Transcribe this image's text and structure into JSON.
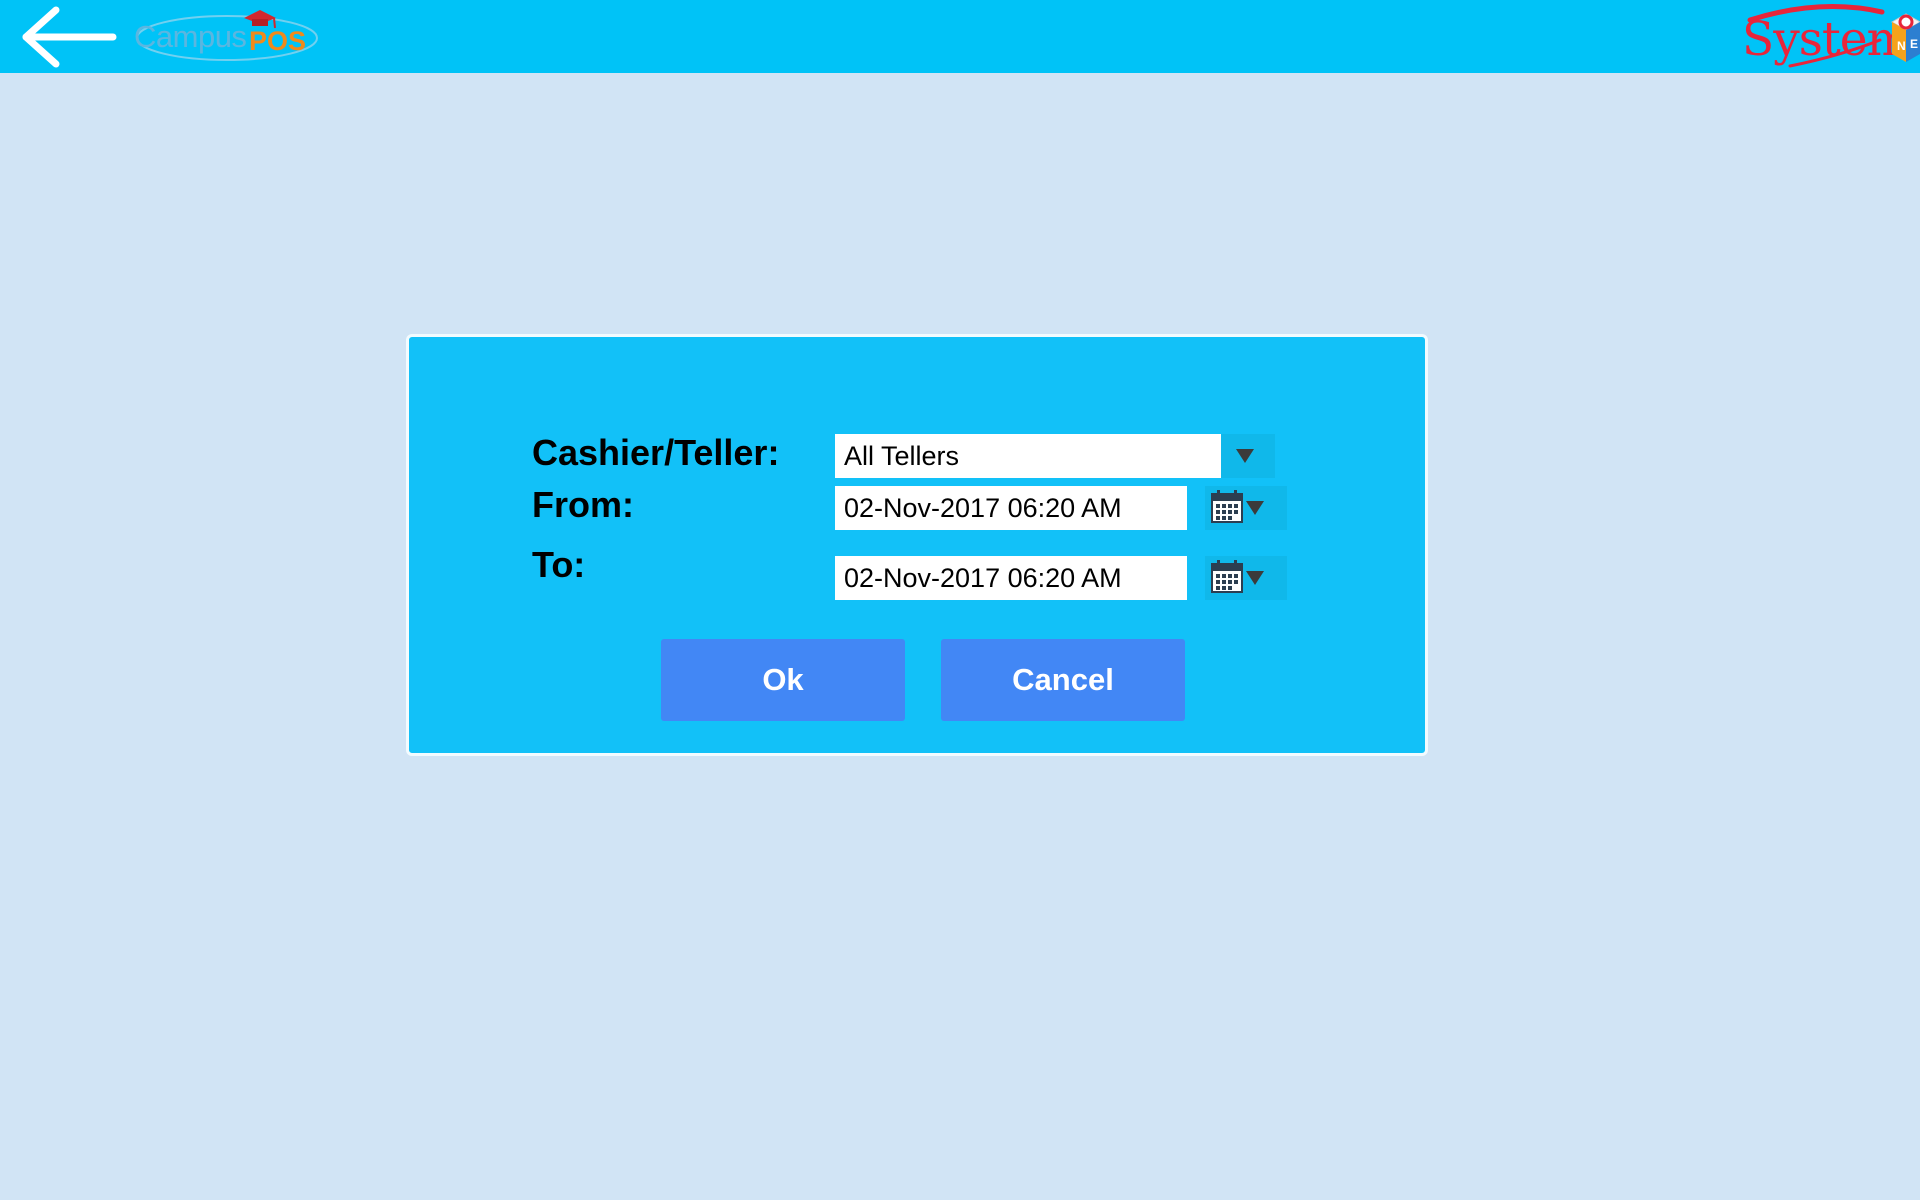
{
  "header": {
    "back_icon": "arrow-left-icon",
    "app_logo": {
      "word1": "Campus",
      "word2": "POS",
      "icon": "graduation-cap-icon"
    },
    "vendor_logo": {
      "word": "System",
      "icon": "cube-icon"
    },
    "bar_color": "#00c3f7"
  },
  "dialog": {
    "cashier_label": "Cashier/Teller:",
    "cashier_value": "All Tellers",
    "from_label": "From:",
    "from_value": "02-Nov-2017 06:20 AM",
    "to_label": "To:",
    "to_value": "02-Nov-2017 06:20 AM",
    "ok_label": "Ok",
    "cancel_label": "Cancel",
    "dropdown_icon": "chevron-down-icon",
    "calendar_icon": "calendar-icon",
    "background_color": "#12c1f8",
    "button_color": "#4287f5"
  },
  "page": {
    "background_color": "#d1e4f5"
  }
}
